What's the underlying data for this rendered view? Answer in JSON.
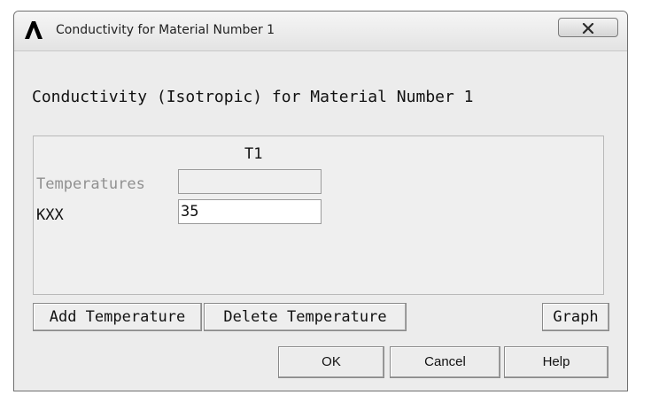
{
  "window": {
    "title": "Conductivity for Material Number 1",
    "app_icon": "ansys-lambda-icon",
    "close_icon": "close-x-icon"
  },
  "dialog": {
    "heading": "Conductivity (Isotropic) for Material Number 1"
  },
  "table": {
    "column_header": "T1",
    "rows": [
      {
        "label": "Temperatures",
        "value": "",
        "enabled": false
      },
      {
        "label": "KXX",
        "value": "35",
        "enabled": true
      }
    ]
  },
  "buttons": {
    "add_temperature": "Add Temperature",
    "delete_temperature": "Delete Temperature",
    "graph": "Graph",
    "ok": "OK",
    "cancel": "Cancel",
    "help": "Help"
  }
}
